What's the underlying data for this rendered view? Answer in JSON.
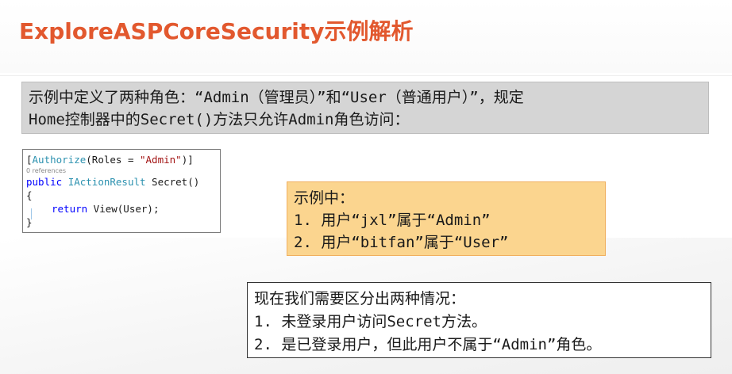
{
  "slide": {
    "title": "ExploreASPCoreSecurity示例解析"
  },
  "intro": {
    "line1": "示例中定义了两种角色：“Admin（管理员）”和“User（普通用户）”，规定",
    "line2": "Home控制器中的Secret()方法只允许Admin角色访问："
  },
  "code": {
    "bracket_open": "[",
    "authorize": "Authorize",
    "roles_prefix": "(Roles = ",
    "roles_value": "\"Admin\"",
    "roles_suffix": ")]",
    "references": "0 references",
    "kw_public": "public",
    "return_type": "IActionResult",
    "method": " Secret()",
    "brace_open": "{",
    "kw_return": "return",
    "return_expr": " View(User);",
    "brace_close": "}"
  },
  "example": {
    "heading": "示例中：",
    "item1": "1. 用户“jxl”属于“Admin”",
    "item2": "2. 用户“bitfan”属于“User”"
  },
  "cases": {
    "heading": "现在我们需要区分出两种情况：",
    "item1": "1. 未登录用户访问Secret方法。",
    "item2": "2. 是已登录用户，但此用户不属于“Admin”角色。"
  },
  "colors": {
    "title": "#e2582e",
    "intro_bg": "#d5d5d5",
    "example_bg": "#fbd58f",
    "keyword": "#0000ff",
    "type": "#2b91af",
    "string": "#a31515"
  }
}
